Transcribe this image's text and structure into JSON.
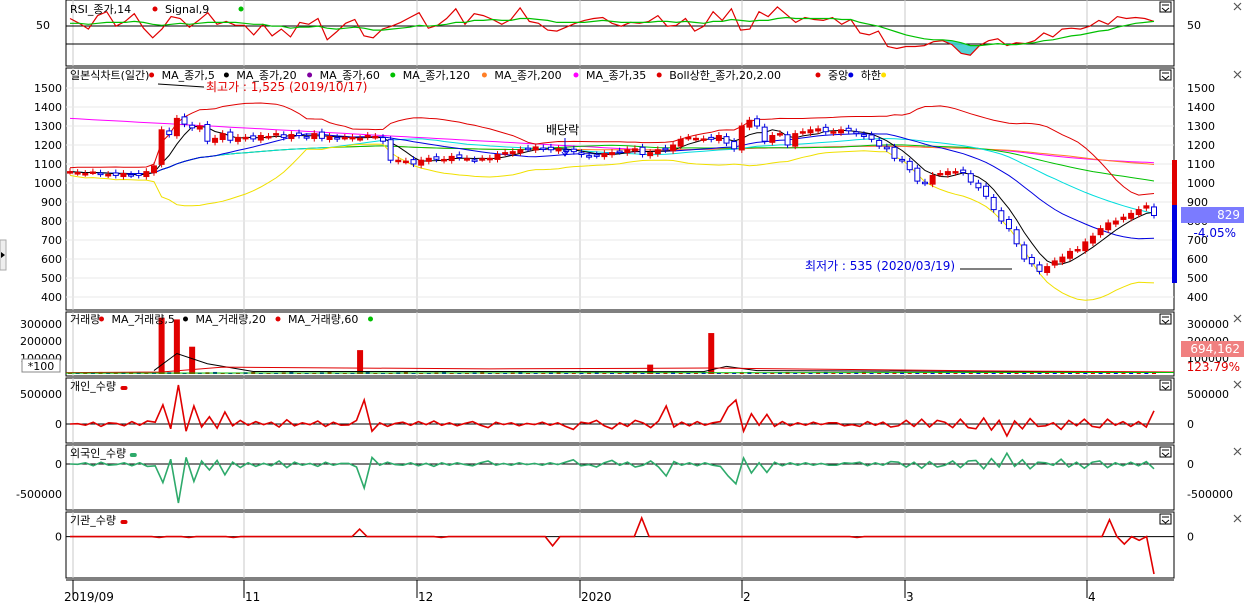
{
  "chart_data": [
    {
      "panel": "rsi",
      "type": "line",
      "legend": [
        {
          "text": "RSI_종가,14",
          "color": "#e00000"
        },
        {
          "text": "Signal,9",
          "color": "#00c000"
        }
      ],
      "y_ticks": [
        "50"
      ],
      "series": [
        {
          "name": "RSI_종가,14",
          "values": [
            55,
            50,
            44,
            58,
            62,
            47,
            52,
            60,
            45,
            35,
            44,
            57,
            55,
            46,
            53,
            61,
            49,
            52,
            48,
            48,
            38,
            49,
            37,
            44,
            36,
            51,
            49,
            55,
            33,
            41,
            50,
            54,
            37,
            35,
            44,
            47,
            51,
            56,
            61,
            45,
            48,
            55,
            65,
            49,
            60,
            58,
            54,
            49,
            54,
            66,
            52,
            50,
            43,
            42,
            46,
            50,
            53,
            55,
            56,
            50,
            47,
            51,
            50,
            52,
            58,
            47,
            48,
            55,
            42,
            47,
            62,
            53,
            65,
            43,
            44,
            62,
            57,
            67,
            59,
            51,
            56,
            54,
            53,
            56,
            49,
            54,
            40,
            38,
            42,
            26,
            24,
            26,
            26,
            27,
            31,
            32,
            28,
            19,
            17,
            27,
            32,
            34,
            27,
            30,
            29,
            32,
            40,
            36,
            44,
            45,
            44,
            47,
            53,
            49,
            57,
            55,
            56,
            55,
            52
          ]
        },
        {
          "name": "Signal,9",
          "values": [
            50,
            50,
            49,
            50,
            51,
            51,
            51,
            52,
            51,
            49,
            48,
            49,
            50,
            49,
            50,
            51,
            51,
            51,
            51,
            50,
            49,
            49,
            47,
            47,
            45,
            46,
            46,
            47,
            45,
            44,
            45,
            46,
            45,
            43,
            43,
            44,
            45,
            46,
            48,
            47,
            48,
            49,
            51,
            51,
            53,
            53,
            54,
            53,
            53,
            55,
            55,
            54,
            53,
            51,
            51,
            51,
            51,
            52,
            53,
            52,
            51,
            51,
            51,
            51,
            52,
            52,
            51,
            52,
            51,
            50,
            52,
            52,
            54,
            53,
            52,
            53,
            53,
            55,
            56,
            55,
            55,
            55,
            55,
            55,
            54,
            54,
            51,
            49,
            47,
            44,
            41,
            38,
            36,
            34,
            33,
            33,
            32,
            30,
            27,
            27,
            28,
            29,
            28,
            28,
            29,
            30,
            32,
            33,
            35,
            37,
            38,
            40,
            42,
            43,
            46,
            48,
            50,
            51,
            52
          ]
        }
      ]
    },
    {
      "panel": "price",
      "type": "candlestick",
      "legend": [
        {
          "text": "일본식차트(일간)",
          "color": "#e00000"
        },
        {
          "text": "MA_종가,5",
          "color": "#000000"
        },
        {
          "text": "MA_종가,20",
          "color": "#8000a0"
        },
        {
          "text": "MA_종가,60",
          "color": "#00c000"
        },
        {
          "text": "MA_종가,120",
          "color": "#ff7f27"
        },
        {
          "text": "MA_종가,200",
          "color": "#ff00ff"
        },
        {
          "text": "MA_종가,35",
          "color": "#e00000"
        },
        {
          "text": "Boll상한_종가,20,2.00",
          "color": "#e00000"
        },
        {
          "text": "중앙",
          "color": "#0000e0"
        },
        {
          "text": "하한",
          "color": "#ffe000"
        }
      ],
      "y_ticks": [
        "1500",
        "1400",
        "1300",
        "1200",
        "1100",
        "1000",
        "900",
        "800",
        "700",
        "600",
        "500",
        "400"
      ],
      "x_ticks": [
        "2019/09",
        "11",
        "12",
        "2020",
        "2",
        "3",
        "4"
      ],
      "high_annotation": "최고가 : 1,525 (2019/10/17)",
      "low_annotation": "최저가 : 535 (2020/03/19)",
      "dividend_annotation": "배당락",
      "current_price": "829",
      "change_pct": "-4.05%",
      "close": [
        1060,
        1055,
        1050,
        1058,
        1048,
        1045,
        1040,
        1050,
        1042,
        1040,
        1060,
        1090,
        1280,
        1255,
        1340,
        1310,
        1290,
        1300,
        1220,
        1235,
        1260,
        1225,
        1240,
        1240,
        1232,
        1250,
        1245,
        1260,
        1240,
        1255,
        1250,
        1240,
        1260,
        1235,
        1245,
        1232,
        1240,
        1240,
        1234,
        1250,
        1245,
        1220,
        1120,
        1120,
        1115,
        1100,
        1120,
        1130,
        1125,
        1124,
        1140,
        1134,
        1128,
        1120,
        1128,
        1130,
        1150,
        1160,
        1165,
        1175,
        1180,
        1190,
        1180,
        1175,
        1180,
        1170,
        1165,
        1150,
        1140,
        1145,
        1155,
        1160,
        1165,
        1175,
        1180,
        1150,
        1160,
        1175,
        1175,
        1200,
        1230,
        1240,
        1235,
        1232,
        1230,
        1250,
        1210,
        1180,
        1300,
        1330,
        1300,
        1220,
        1250,
        1260,
        1200,
        1260,
        1270,
        1280,
        1285,
        1270,
        1270,
        1280,
        1275,
        1260,
        1245,
        1230,
        1195,
        1180,
        1130,
        1120,
        1070,
        1010,
        1000,
        1040,
        1050,
        1060,
        1060,
        1055,
        1005,
        975,
        930,
        860,
        800,
        760,
        680,
        600,
        575,
        535,
        560,
        590,
        610,
        640,
        650,
        690,
        720,
        760,
        790,
        800,
        820,
        840,
        860,
        880,
        829
      ]
    },
    {
      "panel": "volume",
      "type": "bar",
      "legend": [
        {
          "text": "거래량",
          "color": "#e00000"
        },
        {
          "text": "MA_거래량,5",
          "color": "#000000"
        },
        {
          "text": "MA_거래량,20",
          "color": "#e00000"
        },
        {
          "text": "MA_거래량,60",
          "color": "#00c000"
        }
      ],
      "y_ticks": [
        "300000",
        "200000",
        "100000"
      ],
      "unit_label": "*100",
      "current_value": "694,162",
      "change_pct": "123.79%",
      "spikes": [
        {
          "index": 12,
          "value": 330000
        },
        {
          "index": 14,
          "value": 320000
        },
        {
          "index": 16,
          "value": 160000
        },
        {
          "index": 38,
          "value": 140000
        },
        {
          "index": 76,
          "value": 55000
        },
        {
          "index": 84,
          "value": 240000
        }
      ]
    },
    {
      "panel": "individual",
      "type": "line",
      "legend": [
        {
          "text": "개인_수량",
          "color": "#e00000"
        }
      ],
      "y_ticks": [
        "500000",
        "0"
      ],
      "values": [
        0,
        5000,
        -20000,
        30000,
        -40000,
        20000,
        10000,
        -30000,
        40000,
        -20000,
        50000,
        30000,
        320000,
        -80000,
        650000,
        -120000,
        300000,
        -50000,
        120000,
        -70000,
        200000,
        -30000,
        60000,
        -20000,
        40000,
        -10000,
        30000,
        -50000,
        70000,
        -30000,
        20000,
        -10000,
        50000,
        -40000,
        30000,
        -20000,
        -15000,
        60000,
        400000,
        -120000,
        20000,
        -40000,
        10000,
        30000,
        -20000,
        40000,
        -10000,
        50000,
        -20000,
        20000,
        -30000,
        10000,
        40000,
        -20000,
        -60000,
        30000,
        -10000,
        20000,
        -30000,
        10000,
        -10000,
        30000,
        -20000,
        20000,
        -40000,
        -90000,
        30000,
        10000,
        60000,
        -30000,
        -80000,
        20000,
        -40000,
        60000,
        20000,
        -60000,
        50000,
        300000,
        -50000,
        30000,
        -30000,
        40000,
        -20000,
        20000,
        40000,
        280000,
        400000,
        -120000,
        170000,
        -20000,
        160000,
        -40000,
        40000,
        -30000,
        20000,
        -20000,
        30000,
        -10000,
        20000,
        20000,
        -30000,
        -10000,
        -40000,
        40000,
        -20000,
        30000,
        -50000,
        -30000,
        60000,
        -40000,
        80000,
        -50000,
        60000,
        30000,
        -60000,
        80000,
        -60000,
        -80000,
        100000,
        -100000,
        60000,
        -200000,
        50000,
        -80000,
        90000,
        -40000,
        -30000,
        20000,
        -90000,
        60000,
        -30000,
        80000,
        -40000,
        -60000,
        80000,
        -20000,
        40000,
        -40000,
        40000,
        -50000,
        220000
      ]
    },
    {
      "panel": "foreign",
      "type": "line",
      "legend": [
        {
          "text": "외국인_수량",
          "color": "#2eaa6b"
        }
      ],
      "y_ticks": [
        "0",
        "-500000"
      ],
      "values": [
        0,
        -5000,
        20000,
        -30000,
        30000,
        -20000,
        -10000,
        20000,
        -30000,
        20000,
        -40000,
        -30000,
        -310000,
        80000,
        -650000,
        110000,
        -290000,
        50000,
        -100000,
        60000,
        -180000,
        30000,
        -60000,
        20000,
        -40000,
        10000,
        -30000,
        50000,
        -60000,
        30000,
        -20000,
        10000,
        -40000,
        30000,
        -20000,
        10000,
        10000,
        -50000,
        -400000,
        110000,
        -20000,
        30000,
        -10000,
        -20000,
        20000,
        -30000,
        10000,
        -40000,
        20000,
        -20000,
        20000,
        -10000,
        -30000,
        20000,
        50000,
        -20000,
        10000,
        -20000,
        20000,
        -10000,
        10000,
        -20000,
        20000,
        -10000,
        30000,
        70000,
        -30000,
        -10000,
        -50000,
        20000,
        60000,
        -20000,
        30000,
        -50000,
        -20000,
        50000,
        -50000,
        -200000,
        40000,
        -20000,
        20000,
        -30000,
        20000,
        -20000,
        -40000,
        -200000,
        -330000,
        100000,
        -150000,
        20000,
        -140000,
        30000,
        -30000,
        20000,
        -20000,
        20000,
        -20000,
        10000,
        -20000,
        -20000,
        20000,
        10000,
        30000,
        -30000,
        20000,
        -20000,
        40000,
        30000,
        -50000,
        30000,
        -70000,
        40000,
        -50000,
        -20000,
        50000,
        -60000,
        50000,
        60000,
        -80000,
        90000,
        -50000,
        180000,
        -40000,
        70000,
        -80000,
        30000,
        20000,
        -20000,
        80000,
        -50000,
        30000,
        -70000,
        30000,
        50000,
        -60000,
        20000,
        -30000,
        30000,
        -30000,
        40000,
        -80000
      ]
    },
    {
      "panel": "institution",
      "type": "line",
      "legend": [
        {
          "text": "기관_수량",
          "color": "#e00000"
        }
      ],
      "y_ticks": [
        "0"
      ],
      "values": [
        0,
        0,
        0,
        0,
        0,
        0,
        0,
        0,
        0,
        0,
        0,
        0,
        -5000,
        0,
        0,
        0,
        -5000,
        0,
        0,
        0,
        0,
        0,
        -5000,
        0,
        0,
        0,
        0,
        0,
        0,
        0,
        0,
        0,
        0,
        0,
        0,
        0,
        0,
        0,
        0,
        40000,
        0,
        0,
        0,
        0,
        0,
        0,
        0,
        0,
        0,
        0,
        -5000,
        0,
        0,
        0,
        0,
        0,
        0,
        0,
        0,
        0,
        0,
        0,
        0,
        0,
        0,
        -50000,
        0,
        0,
        0,
        0,
        0,
        0,
        0,
        0,
        0,
        0,
        0,
        100000,
        0,
        0,
        0,
        0,
        0,
        0,
        0,
        0,
        0,
        0,
        0,
        0,
        0,
        0,
        0,
        0,
        0,
        0,
        0,
        0,
        0,
        0,
        0,
        0,
        0,
        0,
        0,
        0,
        -5000,
        0,
        0,
        0,
        0,
        0,
        0,
        0,
        0,
        0,
        0,
        0,
        0,
        0,
        0,
        0,
        0,
        0,
        0,
        0,
        0,
        0,
        0,
        0,
        0,
        0,
        0,
        0,
        0,
        0,
        0,
        0,
        0,
        0,
        90000,
        0,
        -40000,
        0,
        -20000,
        0,
        -200000
      ]
    }
  ]
}
